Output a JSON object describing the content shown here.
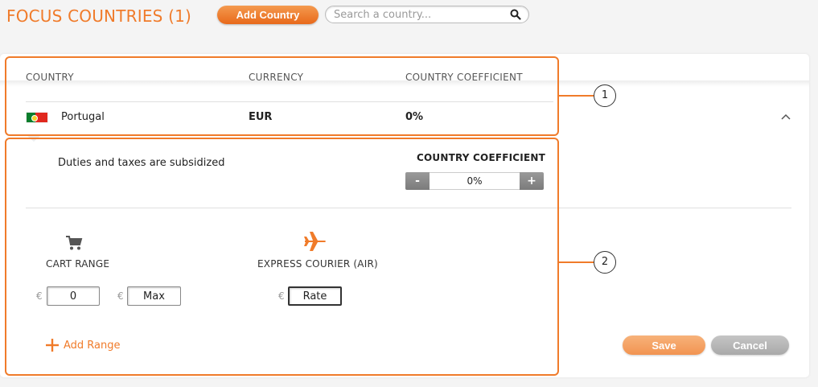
{
  "header": {
    "title": "FOCUS COUNTRIES (1)",
    "add_country_label": "Add Country",
    "search_placeholder": "Search a country..."
  },
  "table": {
    "columns": [
      "COUNTRY",
      "CURRENCY",
      "COUNTRY COEFFICIENT"
    ],
    "rows": [
      {
        "country": "Portugal",
        "currency": "EUR",
        "coefficient": "0%",
        "flag_icon": "portugal-flag-icon"
      }
    ]
  },
  "details": {
    "duties_text": "Duties and taxes are subsidized",
    "coefficient_heading": "COUNTRY COEFFICIENT",
    "coefficient_value": "0%",
    "minus_label": "-",
    "plus_label": "+",
    "cart_range_label": "CART RANGE",
    "express_label": "EXPRESS COURIER (AIR)",
    "currency_symbol": "€",
    "min_value": "0",
    "max_value": "Max",
    "rate_value": "Rate",
    "add_range_label": "Add Range",
    "save_label": "Save",
    "cancel_label": "Cancel"
  },
  "callouts": [
    "1",
    "2"
  ],
  "colors": {
    "accent": "#f07b2a",
    "button_gray": "#8a8a8a",
    "cancel_gray": "#b5b5b5"
  },
  "icons": [
    "search-icon",
    "chevron-up-icon",
    "cart-icon",
    "airplane-icon",
    "plus-icon"
  ]
}
